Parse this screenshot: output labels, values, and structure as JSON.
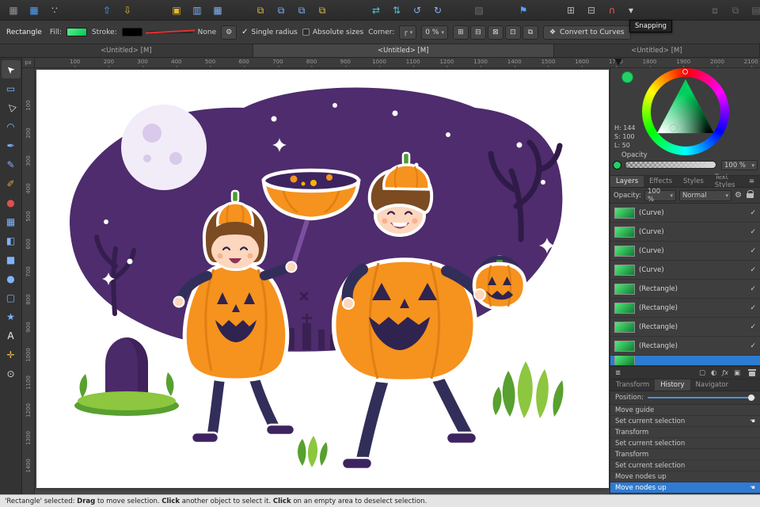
{
  "palette": {
    "accent_blue": "#2e7bd2",
    "toolbar_bg": "#2e2e2e",
    "panel_bg": "#3d3d3d",
    "fill_green": "#00d95f",
    "snap_red": "#ff5352",
    "illustration_purple": "#4e2c6d",
    "illustration_orange": "#f6921e",
    "illustration_navy": "#312e59",
    "illustration_green": "#8dc63f",
    "illustration_moon": "#f2ecf8"
  },
  "glyphs": {
    "gear": "⚙",
    "caret": "▾",
    "check": "✓",
    "corner_style": "┌",
    "hamburger": "≡",
    "fx": "ƒx",
    "stack": "≣",
    "mask": "▢",
    "adjust": "◐",
    "new_layer": "▣",
    "cursor": "☚",
    "convert_icon": "❖",
    "geom1": "⊞",
    "geom2": "⊟",
    "geom3": "⊠",
    "geom4": "⊡",
    "geom5": "⧉"
  },
  "top_toolbar": {
    "tooltip": "Snapping",
    "buttons": [
      {
        "name": "app-button",
        "icon": "app-grid-icon",
        "glyph": "▦",
        "color": "#8e939a",
        "gap": 6
      },
      {
        "name": "pixel-persona-button",
        "icon": "pixel-persona-icon",
        "glyph": "▦",
        "color": "#4da3ff",
        "gap": 4
      },
      {
        "name": "share-button",
        "icon": "share-icon",
        "glyph": "∵",
        "color": "#c7ccd1",
        "gap": 4
      },
      {
        "name": "insert-top-button",
        "icon": "insert-top-icon",
        "glyph": "⇧",
        "color": "#4da3ff",
        "gap": 44
      },
      {
        "name": "insert-bottom-button",
        "icon": "insert-bottom-icon",
        "glyph": "⇩",
        "color": "#e8b931",
        "gap": 4
      },
      {
        "name": "select-box-button",
        "icon": "marquee-icon",
        "glyph": "▣",
        "color": "#e8b931",
        "gap": 40
      },
      {
        "name": "select-layer-button",
        "icon": "marquee-layer-icon",
        "glyph": "▥",
        "color": "#7fb3ff",
        "gap": 4
      },
      {
        "name": "select-group-button",
        "icon": "marquee-group-icon",
        "glyph": "▦",
        "color": "#7fb3ff",
        "gap": 4
      },
      {
        "name": "move-to-front-button",
        "icon": "to-front-icon",
        "glyph": "⧉",
        "color": "#e8b931",
        "gap": 32
      },
      {
        "name": "move-forward-button",
        "icon": "forward-icon",
        "glyph": "⧉",
        "color": "#7fb3ff",
        "gap": 4
      },
      {
        "name": "move-backward-button",
        "icon": "backward-icon",
        "glyph": "⧉",
        "color": "#7fb3ff",
        "gap": 4
      },
      {
        "name": "move-to-back-button",
        "icon": "to-back-icon",
        "glyph": "⧉",
        "color": "#e8b931",
        "gap": 4
      },
      {
        "name": "flip-horizontal-button",
        "icon": "flip-horizontal-icon",
        "glyph": "⇄",
        "color": "#53c6d8",
        "gap": 46
      },
      {
        "name": "flip-vertical-button",
        "icon": "flip-vertical-icon",
        "glyph": "⇅",
        "color": "#53c6d8",
        "gap": 4
      },
      {
        "name": "rotate-ccw-button",
        "icon": "rotate-ccw-icon",
        "glyph": "↺",
        "color": "#7fb3ff",
        "gap": 4
      },
      {
        "name": "rotate-cw-button",
        "icon": "rotate-cw-icon",
        "glyph": "↻",
        "color": "#7fb3ff",
        "gap": 4
      },
      {
        "name": "style-picker-button",
        "icon": "style-picker-icon",
        "glyph": "▨",
        "color": "#6f6f6f",
        "gap": 30
      },
      {
        "name": "insert-target-button",
        "icon": "flag-icon",
        "glyph": "⚑",
        "color": "#4da3ff",
        "gap": 34
      },
      {
        "name": "pixel-grid-button",
        "icon": "grid-icon",
        "glyph": "⊞",
        "color": "#aab2ba",
        "gap": 38
      },
      {
        "name": "pixel-align-button",
        "icon": "pixel-align-icon",
        "glyph": "⊟",
        "color": "#aab2ba",
        "gap": 4
      },
      {
        "name": "snapping-button",
        "icon": "magnet-icon",
        "glyph": "∩",
        "color": "#ff5352",
        "gap": 4
      },
      {
        "name": "snapping-menu-button",
        "icon": "caret-down-icon",
        "glyph": "▾",
        "color": "#c7ccd1",
        "gap": 2
      },
      {
        "name": "link-button",
        "icon": "link-icon",
        "glyph": "⧈",
        "color": "#63676c",
        "gap": 84
      },
      {
        "name": "duplicate-button",
        "icon": "duplicate-icon",
        "glyph": "⧉",
        "color": "#63676c",
        "gap": 4
      },
      {
        "name": "panel-toggle-button",
        "icon": "panel-icon",
        "glyph": "▤",
        "color": "#63676c",
        "gap": 4
      }
    ]
  },
  "context_toolbar": {
    "tool_label": "Rectangle",
    "fill_label": "Fill:",
    "stroke_label": "Stroke:",
    "stroke_none": "None",
    "single_radius_label": "Single radius",
    "absolute_sizes_label": "Absolute sizes",
    "corner_label": "Corner:",
    "corner_value": "0 %",
    "convert_label": "Convert to Curves"
  },
  "document_tabs": [
    {
      "label": "<Untitled> [M]",
      "active": false,
      "width": "33.3%"
    },
    {
      "label": "<Untitled> [M]",
      "active": true,
      "width": "39.6%"
    },
    {
      "label": "<Untitled> [M]",
      "active": false,
      "width": "27.1%"
    }
  ],
  "rulers": {
    "unit": "px",
    "horizontal": [
      100,
      200,
      300,
      400,
      500,
      600,
      700,
      800,
      900,
      1000,
      1100,
      1200,
      1300,
      1400,
      1500,
      1600,
      1700,
      1800,
      1900,
      2000,
      2100
    ],
    "vertical": [
      100,
      200,
      300,
      400,
      500,
      600,
      700,
      800,
      900,
      1000,
      1100,
      1200,
      1300,
      1400
    ]
  },
  "tools_panel": {
    "tools": [
      {
        "name": "move-tool",
        "icon": "cursor-arrow-icon",
        "glyph": "➤",
        "color": "#ffffff",
        "active": true
      },
      {
        "name": "artboard-tool",
        "icon": "artboard-icon",
        "glyph": "▭",
        "color": "#7fb3ff"
      },
      {
        "name": "node-tool",
        "icon": "node-arrow-icon",
        "glyph": "▷",
        "color": "#e8e8e8"
      },
      {
        "name": "corner-tool",
        "icon": "corner-node-icon",
        "glyph": "◠",
        "color": "#7fb3ff"
      },
      {
        "name": "pen-tool",
        "icon": "pen-icon",
        "glyph": "✒",
        "color": "#7fb3ff"
      },
      {
        "name": "pencil-tool",
        "icon": "pencil-icon",
        "glyph": "✎",
        "color": "#7fb3ff"
      },
      {
        "name": "vector-brush-tool",
        "icon": "brush-icon",
        "glyph": "✐",
        "color": "#e0a23f"
      },
      {
        "name": "paint-tool",
        "icon": "paint-dot-icon",
        "glyph": "●",
        "color": "#e04f4f"
      },
      {
        "name": "crop-tool",
        "icon": "crop-icon",
        "glyph": "▦",
        "color": "#7fb3ff"
      },
      {
        "name": "fill-tool",
        "icon": "gradient-icon",
        "glyph": "◧",
        "color": "#7fb3ff"
      },
      {
        "name": "rectangle-tool",
        "icon": "rectangle-icon",
        "glyph": "■",
        "color": "#7fb3ff"
      },
      {
        "name": "ellipse-tool",
        "icon": "ellipse-icon",
        "glyph": "●",
        "color": "#7fb3ff"
      },
      {
        "name": "rounded-rectangle-tool",
        "icon": "rounded-rectangle-icon",
        "glyph": "▢",
        "color": "#7fb3ff"
      },
      {
        "name": "star-tool",
        "icon": "star-icon",
        "glyph": "★",
        "color": "#7fb3ff"
      },
      {
        "name": "text-tool",
        "icon": "text-icon",
        "glyph": "A",
        "color": "#f0f0f0"
      },
      {
        "name": "view-tool",
        "icon": "hand-icon",
        "glyph": "✛",
        "color": "#f0c24b"
      },
      {
        "name": "zoom-tool",
        "icon": "magnifier-icon",
        "glyph": "⊙",
        "color": "#cfd8dc"
      }
    ]
  },
  "color_panel": {
    "hsl": [
      "H: 144",
      "S: 100",
      "L: 50"
    ],
    "opacity_label": "Opacity",
    "opacity_value": "100 %"
  },
  "layers_panel": {
    "tabs": [
      {
        "label": "Layers",
        "active": true
      },
      {
        "label": "Effects",
        "active": false
      },
      {
        "label": "Styles",
        "active": false
      },
      {
        "label": "Text Styles",
        "active": false
      }
    ],
    "opacity_label": "Opacity:",
    "opacity_value": "100 %",
    "blend_mode": "Normal",
    "rows": [
      {
        "name": "(Curve)",
        "checked": true
      },
      {
        "name": "(Curve)",
        "checked": true
      },
      {
        "name": "(Curve)",
        "checked": true
      },
      {
        "name": "(Curve)",
        "checked": true
      },
      {
        "name": "(Rectangle)",
        "checked": true
      },
      {
        "name": "(Rectangle)",
        "checked": true
      },
      {
        "name": "(Rectangle)",
        "checked": true
      },
      {
        "name": "(Rectangle)",
        "checked": true
      },
      {
        "name": "",
        "checked": false,
        "selected": true,
        "partial": true
      }
    ]
  },
  "history_panel": {
    "tabs": [
      {
        "label": "Transform",
        "active": false
      },
      {
        "label": "History",
        "active": true
      },
      {
        "label": "Navigator",
        "active": false
      }
    ],
    "position_label": "Position:",
    "items": [
      {
        "label": "Move guide"
      },
      {
        "label": "Set current selection",
        "has_icon": true
      },
      {
        "label": "Transform"
      },
      {
        "label": "Set current selection"
      },
      {
        "label": "Transform"
      },
      {
        "label": "Set current selection"
      },
      {
        "label": "Move nodes up"
      },
      {
        "label": "Move nodes up",
        "selected": true,
        "has_icon": true
      }
    ]
  },
  "status_bar": {
    "p1": "'Rectangle' selected: ",
    "b1": "Drag",
    "p2": " to move selection. ",
    "b2": "Click",
    "p3": " another object to select it. ",
    "b3": "Click",
    "p4": " on an empty area to deselect selection."
  }
}
